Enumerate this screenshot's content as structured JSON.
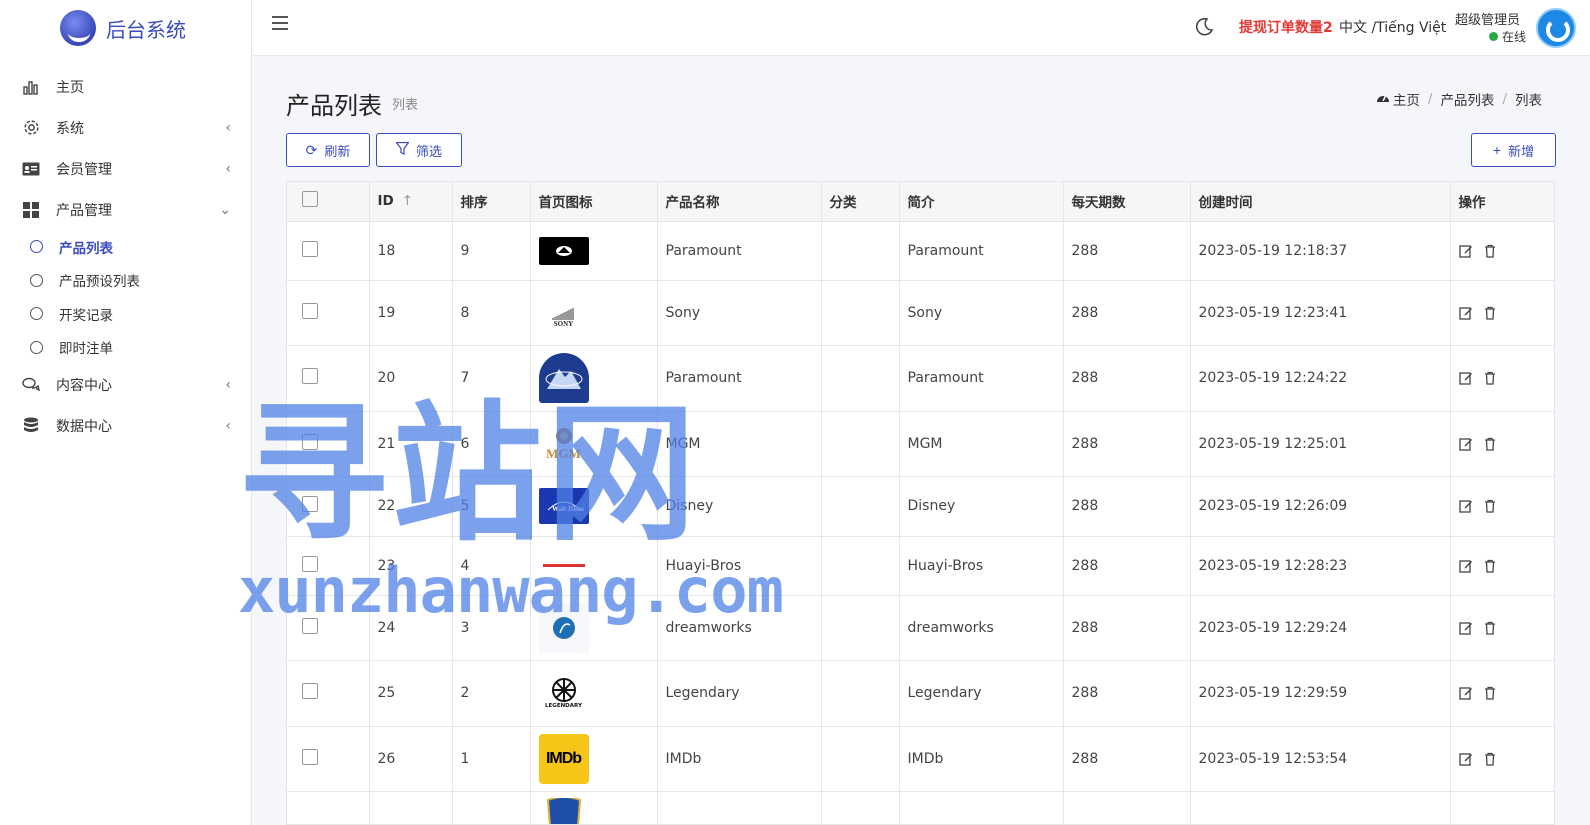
{
  "app": {
    "title": "后台系统"
  },
  "header": {
    "alert": "提现订单数量2",
    "language": "中文 /Tiếng Việt",
    "user_name": "超级管理员",
    "user_status": "在线"
  },
  "sidebar": {
    "items": [
      {
        "label": "主页",
        "icon": "bar-chart-icon",
        "has_arrow": false
      },
      {
        "label": "系统",
        "icon": "gear-icon",
        "has_arrow": true
      },
      {
        "label": "会员管理",
        "icon": "id-card-icon",
        "has_arrow": true
      },
      {
        "label": "产品管理",
        "icon": "grid-icon",
        "has_arrow": true,
        "expanded": true
      },
      {
        "label": "内容中心",
        "icon": "chat-icon",
        "has_arrow": true
      },
      {
        "label": "数据中心",
        "icon": "database-icon",
        "has_arrow": true
      }
    ],
    "sub_items": [
      {
        "label": "产品列表",
        "active": true
      },
      {
        "label": "产品预设列表",
        "active": false
      },
      {
        "label": "开奖记录",
        "active": false
      },
      {
        "label": "即时注单",
        "active": false
      }
    ]
  },
  "page": {
    "title": "产品列表",
    "subtitle": "列表",
    "breadcrumb": [
      "主页",
      "产品列表",
      "列表"
    ]
  },
  "toolbar": {
    "refresh_label": "刷新",
    "filter_label": "筛选",
    "add_label": "新增"
  },
  "table": {
    "columns": [
      "ID",
      "排序",
      "首页图标",
      "产品名称",
      "分类",
      "简介",
      "每天期数",
      "创建时间",
      "操作"
    ],
    "rows": [
      {
        "id": "18",
        "sort": "9",
        "logo": "paramount-dark",
        "name": "Paramount",
        "category": "",
        "intro": "Paramount",
        "periods": "288",
        "created": "2023-05-19 12:18:37"
      },
      {
        "id": "19",
        "sort": "8",
        "logo": "sony",
        "name": "Sony",
        "category": "",
        "intro": "Sony",
        "periods": "288",
        "created": "2023-05-19 12:23:41"
      },
      {
        "id": "20",
        "sort": "7",
        "logo": "paramount-blue",
        "name": "Paramount",
        "category": "",
        "intro": "Paramount",
        "periods": "288",
        "created": "2023-05-19 12:24:22"
      },
      {
        "id": "21",
        "sort": "6",
        "logo": "mgm",
        "name": "MGM",
        "category": "",
        "intro": "MGM",
        "periods": "288",
        "created": "2023-05-19 12:25:01"
      },
      {
        "id": "22",
        "sort": "5",
        "logo": "disney",
        "name": "Disney",
        "category": "",
        "intro": "Disney",
        "periods": "288",
        "created": "2023-05-19 12:26:09"
      },
      {
        "id": "23",
        "sort": "4",
        "logo": "huayi",
        "name": "Huayi-Bros",
        "category": "",
        "intro": "Huayi-Bros",
        "periods": "288",
        "created": "2023-05-19 12:28:23"
      },
      {
        "id": "24",
        "sort": "3",
        "logo": "dreamworks",
        "name": "dreamworks",
        "category": "",
        "intro": "dreamworks",
        "periods": "288",
        "created": "2023-05-19 12:29:24"
      },
      {
        "id": "25",
        "sort": "2",
        "logo": "legendary",
        "name": "Legendary",
        "category": "",
        "intro": "Legendary",
        "periods": "288",
        "created": "2023-05-19 12:29:59"
      },
      {
        "id": "26",
        "sort": "1",
        "logo": "imdb",
        "name": "IMDb",
        "category": "",
        "intro": "IMDb",
        "periods": "288",
        "created": "2023-05-19 12:53:54"
      },
      {
        "id": "",
        "sort": "",
        "logo": "warner",
        "name": "",
        "category": "",
        "intro": "",
        "periods": "",
        "created": ""
      }
    ]
  },
  "logos": {
    "mgm": "MGM",
    "imdb": "IMDb",
    "sony": "SONY",
    "legendary": "LEGENDARY"
  },
  "watermark": {
    "cn": "寻站网",
    "en": "xunzhanwang.com"
  },
  "colors": {
    "accent": "#3a4cc0",
    "alert": "#e53935",
    "online": "#28a745"
  }
}
